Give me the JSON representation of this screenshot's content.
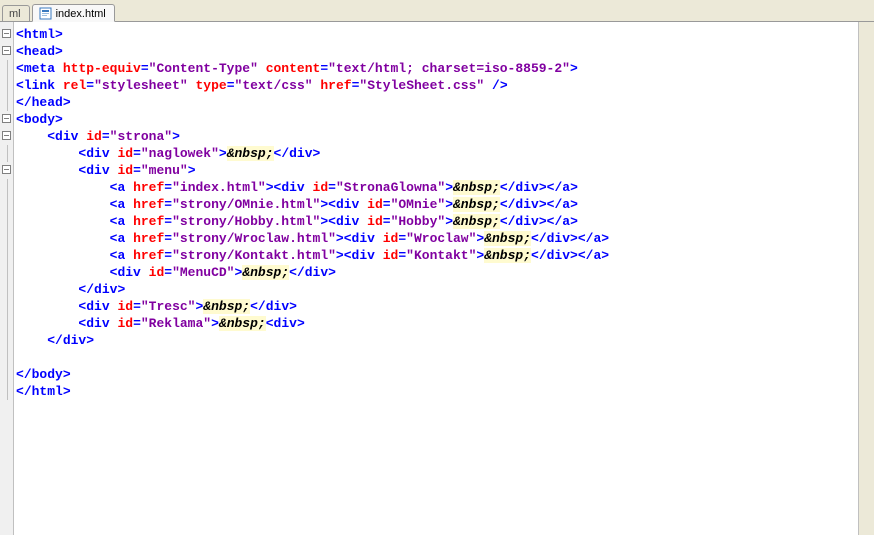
{
  "tabs": {
    "inactive_label": "ml",
    "active_label": "index.html"
  },
  "code": {
    "line1": {
      "tag": "html"
    },
    "line2": {
      "tag": "head"
    },
    "line3": {
      "tag": "meta",
      "attr1": "http-equiv",
      "val1": "\"Content-Type\"",
      "attr2": "content",
      "val2": "\"text/html; charset=iso-8859-2\""
    },
    "line4": {
      "tag": "link",
      "attr1": "rel",
      "val1": "\"stylesheet\"",
      "attr2": "type",
      "val2": "\"text/css\"",
      "attr3": "href",
      "val3": "\"StyleSheet.css\""
    },
    "line5": {
      "tag": "/head"
    },
    "line6": {
      "tag": "body"
    },
    "line7": {
      "indent": "    ",
      "tag": "div",
      "attr": "id",
      "val": "\"strona\""
    },
    "line8": {
      "indent": "        ",
      "tag": "div",
      "attr": "id",
      "val": "\"naglowek\"",
      "entity": "&nbsp;",
      "close": "/div"
    },
    "line9": {
      "indent": "        ",
      "tag": "div",
      "attr": "id",
      "val": "\"menu\""
    },
    "line10": {
      "indent": "            ",
      "tag1": "a",
      "attr1": "href",
      "val1": "\"index.html\"",
      "tag2": "div",
      "attr2": "id",
      "val2": "\"StronaGlowna\"",
      "entity": "&nbsp;",
      "close1": "/div",
      "close2": "/a"
    },
    "line11": {
      "indent": "            ",
      "tag1": "a",
      "attr1": "href",
      "val1": "\"strony/OMnie.html\"",
      "tag2": "div",
      "attr2": "id",
      "val2": "\"OMnie\"",
      "entity": "&nbsp;",
      "close1": "/div",
      "close2": "/a"
    },
    "line12": {
      "indent": "            ",
      "tag1": "a",
      "attr1": "href",
      "val1": "\"strony/Hobby.html\"",
      "tag2": "div",
      "attr2": "id",
      "val2": "\"Hobby\"",
      "entity": "&nbsp;",
      "close1": "/div",
      "close2": "/a"
    },
    "line13": {
      "indent": "            ",
      "tag1": "a",
      "attr1": "href",
      "val1": "\"strony/Wroclaw.html\"",
      "tag2": "div",
      "attr2": "id",
      "val2": "\"Wroclaw\"",
      "entity": "&nbsp;",
      "close1": "/div",
      "close2": "/a"
    },
    "line14": {
      "indent": "            ",
      "tag1": "a",
      "attr1": "href",
      "val1": "\"strony/Kontakt.html\"",
      "tag2": "div",
      "attr2": "id",
      "val2": "\"Kontakt\"",
      "entity": "&nbsp;",
      "close1": "/div",
      "close2": "/a"
    },
    "line15": {
      "indent": "            ",
      "tag": "div",
      "attr": "id",
      "val": "\"MenuCD\"",
      "entity": "&nbsp;",
      "close": "/div"
    },
    "line16": {
      "indent": "        ",
      "tag": "/div"
    },
    "line17": {
      "indent": "        ",
      "tag": "div",
      "attr": "id",
      "val": "\"Tresc\"",
      "entity": "&nbsp;",
      "close": "/div"
    },
    "line18": {
      "indent": "        ",
      "tag": "div",
      "attr": "id",
      "val": "\"Reklama\"",
      "entity": "&nbsp;",
      "close": "div"
    },
    "line19": {
      "indent": "    ",
      "tag": "/div"
    },
    "line21": {
      "tag": "/body"
    },
    "line22": {
      "tag": "/html"
    }
  }
}
